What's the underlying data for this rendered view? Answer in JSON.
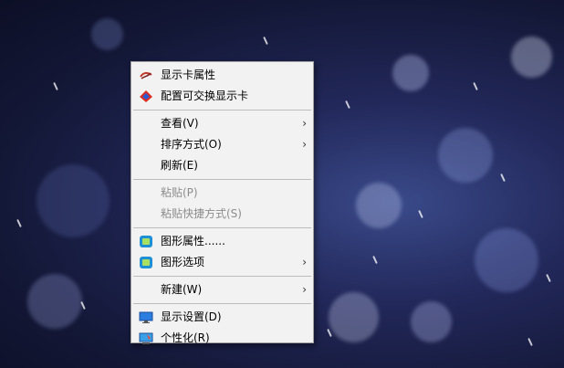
{
  "context_menu": {
    "items": [
      {
        "label": "显示卡属性",
        "icon": "nvidia-swirl-icon"
      },
      {
        "label": "配置可交换显示卡",
        "icon": "amd-radeon-icon"
      },
      {
        "label": "查看(V)",
        "submenu": true
      },
      {
        "label": "排序方式(O)",
        "submenu": true
      },
      {
        "label": "刷新(E)"
      },
      {
        "label": "粘贴(P)",
        "disabled": true
      },
      {
        "label": "粘贴快捷方式(S)",
        "disabled": true
      },
      {
        "label": "图形属性......",
        "icon": "intel-graphics-icon"
      },
      {
        "label": "图形选项",
        "icon": "intel-graphics-icon",
        "submenu": true
      },
      {
        "label": "新建(W)",
        "submenu": true
      },
      {
        "label": "显示设置(D)",
        "icon": "display-settings-icon"
      },
      {
        "label": "个性化(R)",
        "icon": "personalize-icon"
      }
    ],
    "submenu_arrow": "›"
  }
}
